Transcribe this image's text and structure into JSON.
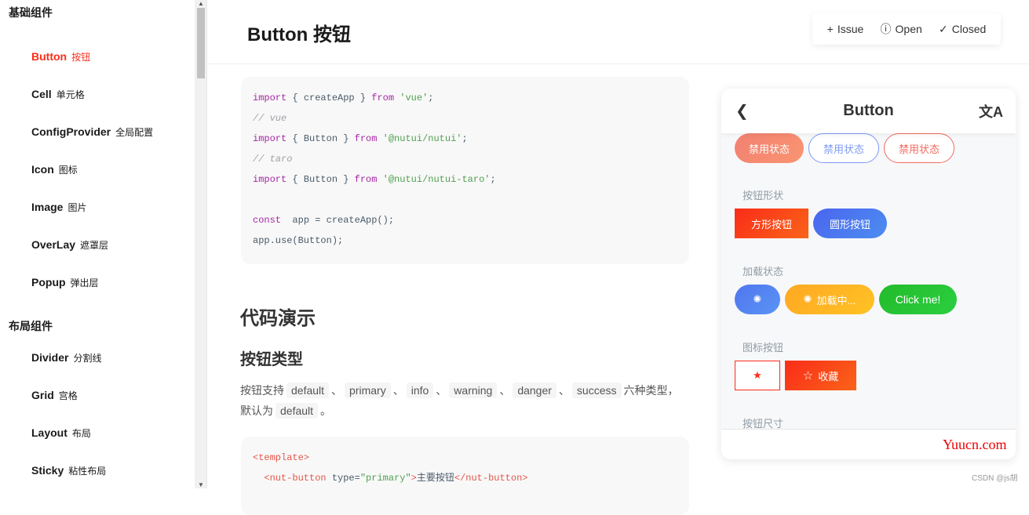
{
  "sidebar": {
    "groups": [
      {
        "title": "基础组件",
        "items": [
          {
            "en": "Button",
            "cn": "按钮",
            "active": true
          },
          {
            "en": "Cell",
            "cn": "单元格"
          },
          {
            "en": "ConfigProvider",
            "cn": "全局配置"
          },
          {
            "en": "Icon",
            "cn": "图标"
          },
          {
            "en": "Image",
            "cn": "图片"
          },
          {
            "en": "OverLay",
            "cn": "遮罩层"
          },
          {
            "en": "Popup",
            "cn": "弹出层"
          }
        ]
      },
      {
        "title": "布局组件",
        "items": [
          {
            "en": "Divider",
            "cn": "分割线"
          },
          {
            "en": "Grid",
            "cn": "宫格"
          },
          {
            "en": "Layout",
            "cn": "布局"
          },
          {
            "en": "Sticky",
            "cn": "粘性布局"
          }
        ]
      }
    ]
  },
  "header": {
    "title": "Button 按钮",
    "links": [
      {
        "icon": "plus-icon",
        "glyph": "+",
        "label": "Issue"
      },
      {
        "icon": "info-circle-icon",
        "glyph": "ⓘ",
        "label": "Open"
      },
      {
        "icon": "check-icon",
        "glyph": "✓",
        "label": "Closed"
      }
    ]
  },
  "code1": [
    [
      [
        "kw",
        "import"
      ],
      [
        "",
        "{ createApp } "
      ],
      [
        "kw",
        "from"
      ],
      [
        "str",
        " 'vue'"
      ],
      [
        "",
        ";"
      ]
    ],
    [
      [
        "cm",
        "// vue"
      ]
    ],
    [
      [
        "kw",
        "import"
      ],
      [
        "",
        "{ Button } "
      ],
      [
        "kw",
        "from"
      ],
      [
        "str",
        " '@nutui/nutui'"
      ],
      [
        "",
        ";"
      ]
    ],
    [
      [
        "cm",
        "// taro"
      ]
    ],
    [
      [
        "kw",
        "import"
      ],
      [
        "",
        "{ Button } "
      ],
      [
        "kw",
        "from"
      ],
      [
        "str",
        " '@nutui/nutui-taro'"
      ],
      [
        "",
        ";"
      ]
    ],
    [
      [
        "",
        ""
      ]
    ],
    [
      [
        "kw",
        "const"
      ],
      [
        "",
        " app = createApp();"
      ]
    ],
    [
      [
        "",
        "app.use(Button);"
      ]
    ]
  ],
  "demo": {
    "heading": "代码演示",
    "subheading": "按钮类型",
    "para": {
      "prefix": "按钮支持",
      "types": [
        "default",
        "primary",
        "info",
        "warning",
        "danger",
        "success"
      ],
      "sep": "、",
      "suffix": "六种类型，",
      "line2_prefix": "默认为",
      "default": "default",
      "end": "。"
    }
  },
  "code2": [
    [
      [
        "tag",
        "<template>"
      ]
    ],
    [
      [
        "tag",
        "  <nut-button"
      ],
      [
        "",
        " type="
      ],
      [
        "str",
        "\"primary\""
      ],
      [
        "tag",
        ">"
      ],
      [
        "",
        "主要按钮"
      ],
      [
        "tag",
        "</nut-button>"
      ]
    ]
  ],
  "phone": {
    "title": "Button",
    "back_icon": "chevron-left-icon",
    "translate_icon": "translate-icon",
    "disabled_buttons": [
      "禁用状态",
      "禁用状态",
      "禁用状态"
    ],
    "shape_label": "按钮形状",
    "shape_buttons": [
      "方形按钮",
      "圆形按钮"
    ],
    "loading_label": "加载状态",
    "loading_text": "加载中...",
    "click_text": "Click me!",
    "icon_label": "图标按钮",
    "collect_text": "收藏",
    "size_label": "按钮尺寸"
  },
  "watermark": "Yuucn.com",
  "credit": "CSDN @js胡",
  "colors": {
    "accent": "#fa2c19",
    "primary": "#4a72f0",
    "warning": "#ffb422",
    "success": "#26bf26"
  }
}
